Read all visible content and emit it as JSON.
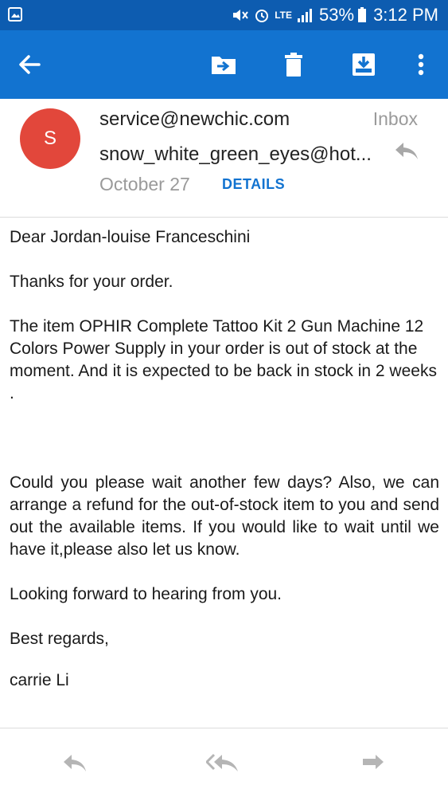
{
  "status_bar": {
    "network": "LTE",
    "battery": "53%",
    "time": "3:12 PM"
  },
  "toolbar": {
    "icons": [
      "back-arrow-icon",
      "move-to-folder-icon",
      "delete-icon",
      "archive-icon",
      "more-vert-icon"
    ]
  },
  "email": {
    "avatar_letter": "S",
    "from": "service@newchic.com",
    "folder": "Inbox",
    "to": "snow_white_green_eyes@hot...",
    "date": "October 27",
    "details_label": "DETAILS",
    "body": {
      "greeting": "Dear Jordan-louise Franceschini",
      "thanks": "Thanks for your order.",
      "item_paragraph": "The item OPHIR Complete Tattoo Kit 2 Gun Machine 12 Colors Power Supply  in your order is out of stock at the moment. And it is expected to be back in stock in 2 weeks .",
      "request_paragraph": "Could you please wait another few days? Also, we can arrange a refund for the out-of-stock item to you and send out the available items. If you would like to wait until we have it,please also let us know.",
      "looking_forward": "Looking forward to hearing from  you.",
      "regards": "Best regards,",
      "signature": "carrie Li"
    }
  },
  "bottom_bar": {
    "icons": [
      "reply-icon",
      "reply-all-icon",
      "forward-icon"
    ]
  },
  "colors": {
    "status_bar": "#0d5cb0",
    "toolbar": "#1273d0",
    "avatar": "#e2473b",
    "link": "#1273d0"
  }
}
